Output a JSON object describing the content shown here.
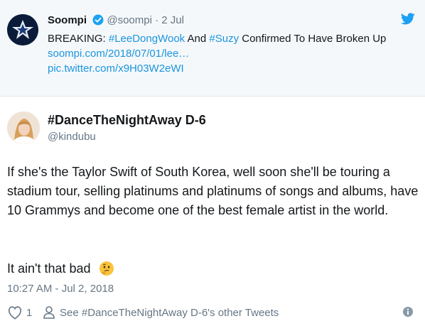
{
  "quoted_tweet": {
    "name": "Soompi",
    "handle": "@soompi",
    "separator": "·",
    "date": "2 Jul",
    "text_prefix": "BREAKING: ",
    "hashtag1": "#LeeDongWook",
    "text_and": " And ",
    "hashtag2": "#Suzy",
    "text_rest": " Confirmed To Have Broken Up ",
    "link": "soompi.com/2018/07/01/lee…",
    "pic_link": "pic.twitter.com/x9H03W2eWI",
    "icons": [
      "verified-icon",
      "twitter-bird-icon"
    ]
  },
  "tweet": {
    "display_name": "#DanceTheNightAway D-6",
    "handle": "@kindubu",
    "text": "If she's the Taylor Swift of South Korea, well soon she'll be touring a stadium tour, selling platinums and platinums of songs and albums, have 10 Grammys and become one of the best female artist in the world.",
    "text2": "It ain't that bad",
    "emoji": "thinking-face-icon",
    "timestamp": "10:27 AM - Jul 2, 2018",
    "likes": "1",
    "other_tweets": "See #DanceTheNightAway D-6's other Tweets"
  },
  "colors": {
    "link": "#1b95e0",
    "muted": "#657786",
    "quoted_bg": "#f5f8fa"
  }
}
